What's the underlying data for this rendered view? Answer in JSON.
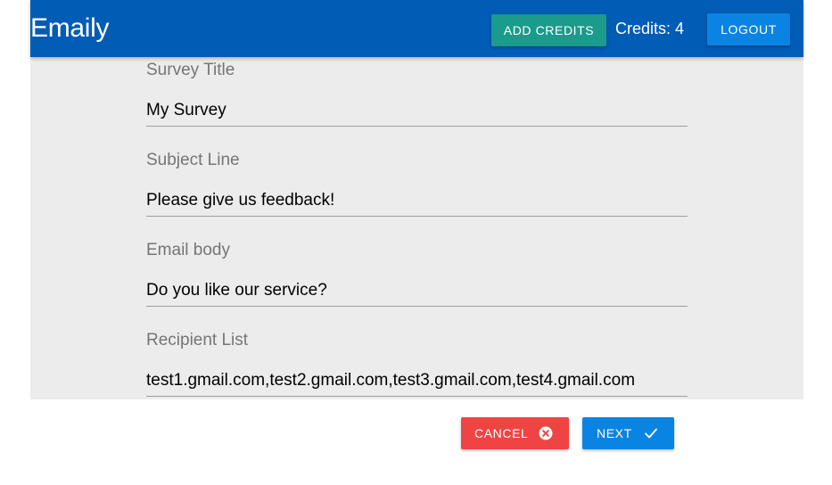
{
  "navbar": {
    "brand": "Emaily",
    "add_credits_label": "Add Credits",
    "credits_text": "Credits: 4",
    "logout_label": "Logout"
  },
  "form": {
    "fields": [
      {
        "label": "Survey Title",
        "value": "My Survey"
      },
      {
        "label": "Subject Line",
        "value": "Please give us feedback!"
      },
      {
        "label": "Email body",
        "value": "Do you like our service?"
      },
      {
        "label": "Recipient List",
        "value": "test1.gmail.com,test2.gmail.com,test3.gmail.com,test4.gmail.com"
      }
    ],
    "cancel_label": "Cancel",
    "next_label": "Next"
  },
  "icons": {
    "cancel": "close-circle-icon",
    "next": "check-icon"
  },
  "colors": {
    "navbar": "#005cb5",
    "add_credits": "#1a9b8c",
    "logout": "#0a84e3",
    "cancel": "#ef4444",
    "next": "#0a84e3",
    "form_background": "#ececec"
  }
}
